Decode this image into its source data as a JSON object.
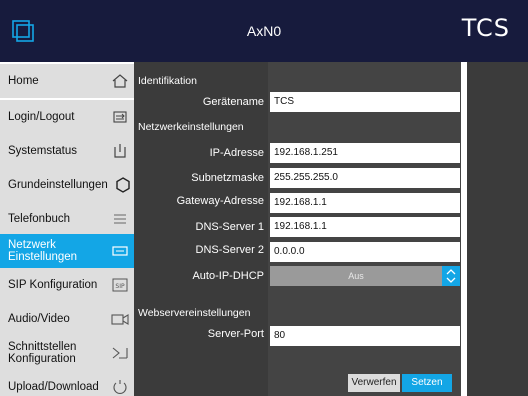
{
  "header": {
    "title": "AxN0",
    "logo": "TCS"
  },
  "colors": {
    "header_bg": "#171b3d",
    "accent": "#13a6e6",
    "panel_bg": "#3b3b3b",
    "sidebar_bg": "#dedede"
  },
  "sidebar": {
    "items": [
      {
        "label": "Home",
        "icon": "home-icon"
      },
      {
        "label": "Login/Logout",
        "icon": "login-logout-icon"
      },
      {
        "label": "Systemstatus",
        "icon": "system-status-icon"
      },
      {
        "label": "Grundeinstellungen",
        "icon": "gear-icon"
      },
      {
        "label": "Telefonbuch",
        "icon": "list-icon"
      },
      {
        "label": "Netzwerk Einstellungen",
        "icon": "network-icon",
        "active": true
      },
      {
        "label": "SIP Konfiguration",
        "icon": "sip-icon"
      },
      {
        "label": "Audio/Video",
        "icon": "video-camera-icon"
      },
      {
        "label": "Schnittstellen Konfiguration",
        "icon": "interface-icon"
      },
      {
        "label": "Upload/Download",
        "icon": "upload-download-icon"
      }
    ]
  },
  "form": {
    "sections": {
      "identification": "Identifikation",
      "network": "Netzwerkeinstellungen",
      "webserver": "Webservereinstellungen"
    },
    "fields": {
      "device_name": {
        "label": "Gerätename",
        "value": "TCS"
      },
      "ip_address": {
        "label": "IP-Adresse",
        "value": "192.168.1.251"
      },
      "subnet_mask": {
        "label": "Subnetzmaske",
        "value": "255.255.255.0"
      },
      "gateway": {
        "label": "Gateway-Adresse",
        "value": "192.168.1.1"
      },
      "dns1": {
        "label": "DNS-Server 1",
        "value": "192.168.1.1"
      },
      "dns2": {
        "label": "DNS-Server 2",
        "value": "0.0.0.0"
      },
      "dhcp": {
        "label": "Auto-IP-DHCP",
        "value": "Aus"
      },
      "server_port": {
        "label": "Server-Port",
        "value": "80"
      }
    },
    "buttons": {
      "discard": "Verwerfen",
      "apply": "Setzen"
    }
  }
}
